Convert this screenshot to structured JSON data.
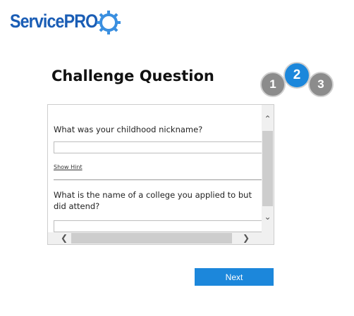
{
  "logo": {
    "text_service": "Service",
    "text_pro": "PRO"
  },
  "header": {
    "title": "Challenge Question"
  },
  "steps": [
    {
      "label": "1",
      "state": "inactive"
    },
    {
      "label": "2",
      "state": "active"
    },
    {
      "label": "3",
      "state": "inactive"
    }
  ],
  "questions": [
    {
      "text": "What was your childhood nickname?",
      "answer": "",
      "hint_label": "Show Hint"
    },
    {
      "text": "What is the name of a college you applied to but did attend?",
      "answer": ""
    }
  ],
  "actions": {
    "next_label": "Next"
  },
  "colors": {
    "accent": "#1c87db",
    "logo_blue": "#1a5db5",
    "step_inactive": "#8c8c8c"
  }
}
